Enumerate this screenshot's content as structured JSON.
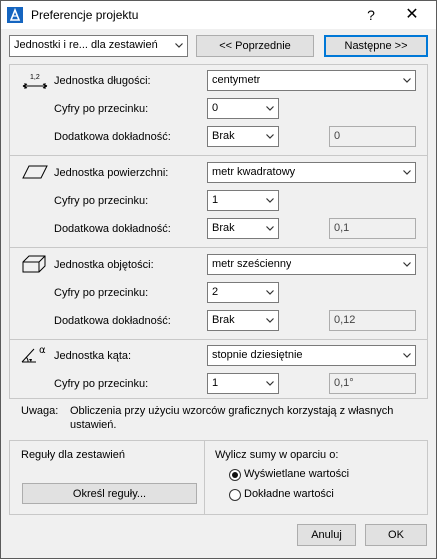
{
  "window": {
    "title": "Preferencje projektu",
    "help_label": "?",
    "close_label": "✕"
  },
  "nav": {
    "page_select": "Jednostki i re... dla zestawień",
    "prev_label": "<< Poprzednie",
    "next_label": "Następne >>"
  },
  "length": {
    "label": "Jednostka długości:",
    "icon_caption": "1,2",
    "unit": "centymetr",
    "decimals_label": "Cyfry po przecinku:",
    "decimals": "0",
    "extra_label": "Dodatkowa dokładność:",
    "extra": "Brak",
    "preview": "0"
  },
  "area": {
    "label": "Jednostka powierzchni:",
    "unit": "metr kwadratowy",
    "decimals_label": "Cyfry po przecinku:",
    "decimals": "1",
    "extra_label": "Dodatkowa dokładność:",
    "extra": "Brak",
    "preview": "0,1"
  },
  "volume": {
    "label": "Jednostka objętości:",
    "unit": "metr sześcienny",
    "decimals_label": "Cyfry po przecinku:",
    "decimals": "2",
    "extra_label": "Dodatkowa dokładność:",
    "extra": "Brak",
    "preview": "0,12"
  },
  "angle": {
    "label": "Jednostka kąta:",
    "icon_caption": "α",
    "unit": "stopnie dziesiętnie",
    "decimals_label": "Cyfry po przecinku:",
    "decimals": "1",
    "preview": "0,1°"
  },
  "note": {
    "label": "Uwaga:",
    "line1": "Obliczenia przy użyciu wzorców graficznych korzystają z własnych",
    "line2": "ustawień."
  },
  "rules": {
    "label": "Reguły dla zestawień",
    "button": "Określ reguły..."
  },
  "sums": {
    "label": "Wylicz sumy w oparciu o:",
    "option1": "Wyświetlane wartości",
    "option2": "Dokładne wartości",
    "selected": "option1"
  },
  "footer": {
    "cancel": "Anuluj",
    "ok": "OK"
  }
}
